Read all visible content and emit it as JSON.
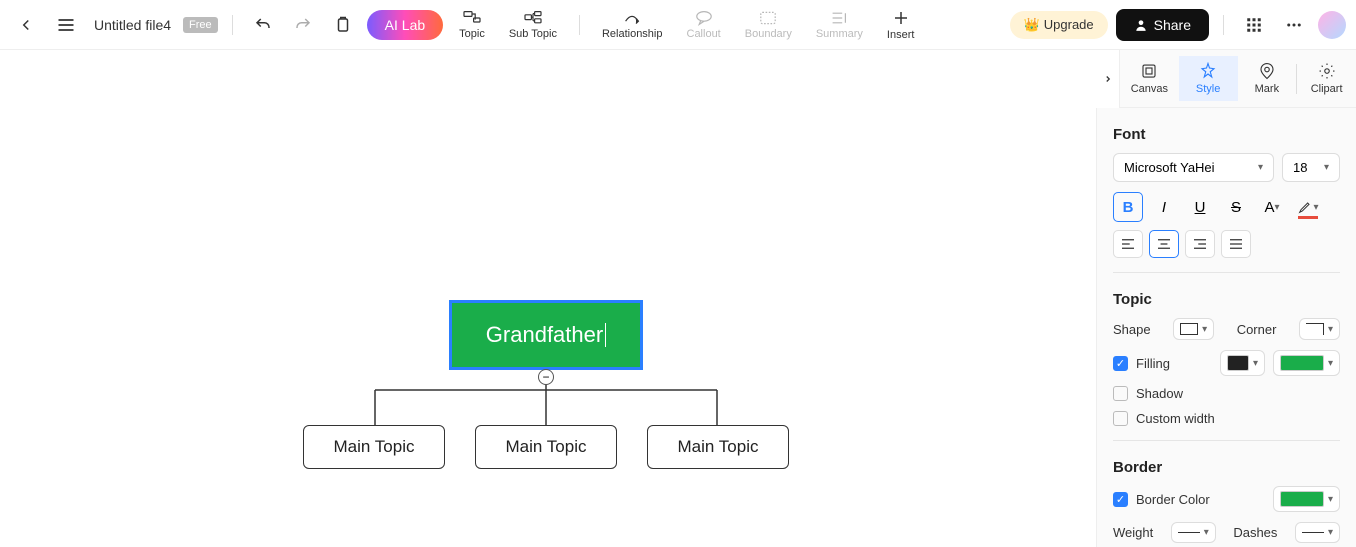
{
  "header": {
    "file_name": "Untitled file4",
    "free_badge": "Free",
    "ai_lab": "AI Lab",
    "tools": {
      "topic": "Topic",
      "sub_topic": "Sub Topic",
      "relationship": "Relationship",
      "callout": "Callout",
      "boundary": "Boundary",
      "summary": "Summary",
      "insert": "Insert"
    },
    "upgrade": "Upgrade",
    "share": "Share"
  },
  "mindmap": {
    "root": "Grandfather",
    "children": [
      "Main Topic",
      "Main Topic",
      "Main Topic"
    ],
    "collapse_symbol": "−"
  },
  "panel_tabs": {
    "canvas": "Canvas",
    "style": "Style",
    "mark": "Mark",
    "clipart": "Clipart"
  },
  "style_panel": {
    "font": {
      "title": "Font",
      "family": "Microsoft YaHei",
      "size": "18"
    },
    "topic": {
      "title": "Topic",
      "shape_label": "Shape",
      "corner_label": "Corner",
      "filling_label": "Filling",
      "shadow_label": "Shadow",
      "custom_width_label": "Custom width",
      "fill_color_1": "#222222",
      "fill_color_2": "#1aad4a"
    },
    "border": {
      "title": "Border",
      "border_color_label": "Border Color",
      "border_color": "#1aad4a",
      "weight_label": "Weight",
      "dashes_label": "Dashes"
    }
  }
}
